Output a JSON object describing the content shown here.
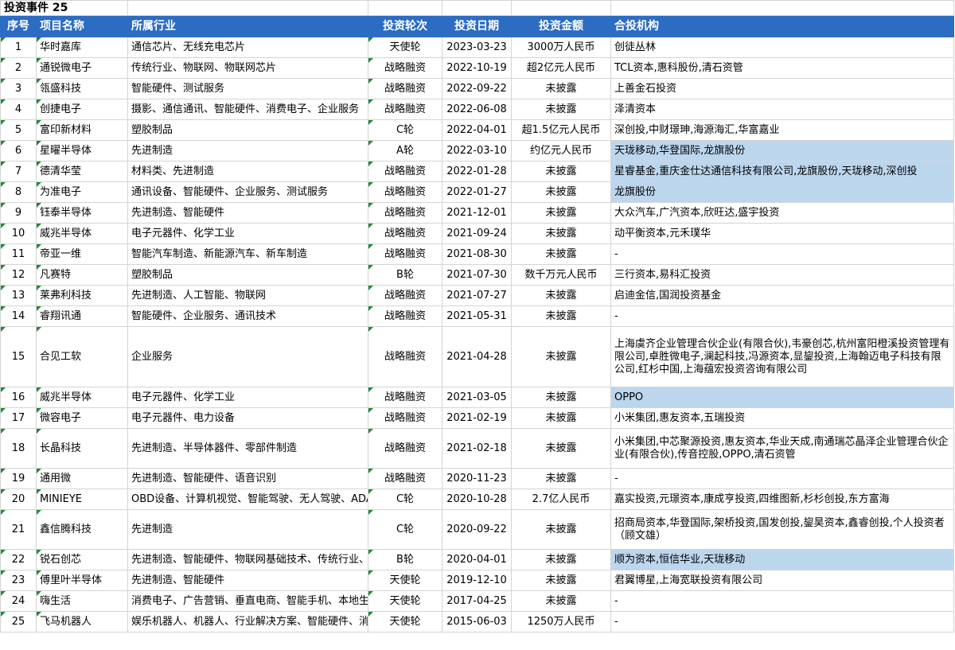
{
  "title": "投资事件 25",
  "headers": [
    "序号",
    "项目名称",
    "所属行业",
    "投资轮次",
    "投资日期",
    "投资金额",
    "合投机构"
  ],
  "rows": [
    {
      "no": "1",
      "name": "华时嘉库",
      "industry": "通信芯片、无线充电芯片",
      "round": "天使轮",
      "date": "2023-03-23",
      "amount": "3000万人民币",
      "investors": "创徒丛林",
      "highlight": false,
      "size": "r"
    },
    {
      "no": "2",
      "name": "通锐微电子",
      "industry": "传统行业、物联网、物联网芯片",
      "round": "战略融资",
      "date": "2022-10-19",
      "amount": "超2亿元人民币",
      "investors": "TCL资本,惠科股份,清石资管",
      "highlight": false,
      "size": "r"
    },
    {
      "no": "3",
      "name": "瓴盛科技",
      "industry": "智能硬件、测试服务",
      "round": "战略融资",
      "date": "2022-09-22",
      "amount": "未披露",
      "investors": "上善金石投资",
      "highlight": false,
      "size": "r"
    },
    {
      "no": "4",
      "name": "创捷电子",
      "industry": "摄影、通信通讯、智能硬件、消费电子、企业服务",
      "round": "战略融资",
      "date": "2022-06-08",
      "amount": "未披露",
      "investors": "泽清资本",
      "highlight": false,
      "size": "r"
    },
    {
      "no": "5",
      "name": "富印新材料",
      "industry": "塑胶制品",
      "round": "C轮",
      "date": "2022-04-01",
      "amount": "超1.5亿元人民币",
      "investors": "深创投,中财璟珅,海源海汇,华富嘉业",
      "highlight": false,
      "size": "r"
    },
    {
      "no": "6",
      "name": "星曜半导体",
      "industry": "先进制造",
      "round": "A轮",
      "date": "2022-03-10",
      "amount": "约亿元人民币",
      "investors": "天珑移动,华登国际,龙旗股份",
      "highlight": true,
      "size": "r"
    },
    {
      "no": "7",
      "name": "德清华莹",
      "industry": "材料类、先进制造",
      "round": "战略融资",
      "date": "2022-01-28",
      "amount": "未披露",
      "investors": "星睿基金,重庆金仕达通信科技有限公司,龙旗股份,天珑移动,深创投",
      "highlight": true,
      "size": "r"
    },
    {
      "no": "8",
      "name": "为准电子",
      "industry": "通讯设备、智能硬件、企业服务、测试服务",
      "round": "战略融资",
      "date": "2022-01-27",
      "amount": "未披露",
      "investors": "龙旗股份",
      "highlight": true,
      "size": "r"
    },
    {
      "no": "9",
      "name": "钰泰半导体",
      "industry": "先进制造、智能硬件",
      "round": "战略融资",
      "date": "2021-12-01",
      "amount": "未披露",
      "investors": "大众汽车,广汽资本,欣旺达,盛宇投资",
      "highlight": false,
      "size": "r"
    },
    {
      "no": "10",
      "name": "威兆半导体",
      "industry": "电子元器件、化学工业",
      "round": "战略融资",
      "date": "2021-09-24",
      "amount": "未披露",
      "investors": "动平衡资本,元禾璞华",
      "highlight": false,
      "size": "r"
    },
    {
      "no": "11",
      "name": "帝亚一维",
      "industry": "智能汽车制造、新能源汽车、新车制造",
      "round": "战略融资",
      "date": "2021-08-30",
      "amount": "未披露",
      "investors": "-",
      "highlight": false,
      "size": "r"
    },
    {
      "no": "12",
      "name": "凡赛特",
      "industry": "塑胶制品",
      "round": "B轮",
      "date": "2021-07-30",
      "amount": "数千万元人民币",
      "investors": "三行资本,易科汇投资",
      "highlight": false,
      "size": "r"
    },
    {
      "no": "13",
      "name": "莱弗利科技",
      "industry": "先进制造、人工智能、物联网",
      "round": "战略融资",
      "date": "2021-07-27",
      "amount": "未披露",
      "investors": "启迪金信,国润投资基金",
      "highlight": false,
      "size": "r"
    },
    {
      "no": "14",
      "name": "睿翔讯通",
      "industry": "智能硬件、企业服务、通讯技术",
      "round": "战略融资",
      "date": "2021-05-31",
      "amount": "未披露",
      "investors": "-",
      "highlight": false,
      "size": "r"
    },
    {
      "no": "15",
      "name": "合见工软",
      "industry": "企业服务",
      "round": "战略融资",
      "date": "2021-04-28",
      "amount": "未披露",
      "investors": "上海虞齐企业管理合伙企业(有限合伙),韦豪创芯,杭州富阳橙溪投资管理有限公司,卓胜微电子,澜起科技,冯源资本,显鋆投资,上海翰迈电子科技有限公司,红杉中国,上海蕴宏投资咨询有限公司",
      "highlight": false,
      "size": "r3"
    },
    {
      "no": "16",
      "name": "威兆半导体",
      "industry": "电子元器件、化学工业",
      "round": "战略融资",
      "date": "2021-03-05",
      "amount": "未披露",
      "investors": "OPPO",
      "highlight": true,
      "size": "r"
    },
    {
      "no": "17",
      "name": "微容电子",
      "industry": "电子元器件、电力设备",
      "round": "战略融资",
      "date": "2021-02-19",
      "amount": "未披露",
      "investors": "小米集团,惠友资本,五瑞投资",
      "highlight": false,
      "size": "r"
    },
    {
      "no": "18",
      "name": "长晶科技",
      "industry": "先进制造、半导体器件、零部件制造",
      "round": "战略融资",
      "date": "2021-02-18",
      "amount": "未披露",
      "investors": "小米集团,中芯聚源投资,惠友资本,华业天成,南通瑞芯晶泽企业管理合伙企业(有限合伙),传音控股,OPPO,清石资管",
      "highlight": false,
      "size": "r2"
    },
    {
      "no": "19",
      "name": "通用微",
      "industry": "先进制造、智能硬件、语音识别",
      "round": "战略融资",
      "date": "2020-11-23",
      "amount": "未披露",
      "investors": "-",
      "highlight": false,
      "size": "r"
    },
    {
      "no": "20",
      "name": "MINIEYE",
      "industry": "OBD设备、计算机视觉、智能驾驶、无人驾驶、ADAS",
      "round": "C轮",
      "date": "2020-10-28",
      "amount": "2.7亿人民币",
      "investors": "嘉实投资,元璟资本,康成亨投资,四维图新,杉杉创投,东方富海",
      "highlight": false,
      "size": "r"
    },
    {
      "no": "21",
      "name": "鑫信腾科技",
      "industry": "先进制造",
      "round": "C轮",
      "date": "2020-09-22",
      "amount": "未披露",
      "investors": "招商局资本,华登国际,架桥投资,国发创投,鋆昊资本,鑫睿创投,个人投资者（顾文雄）",
      "highlight": false,
      "size": "r2"
    },
    {
      "no": "22",
      "name": "锐石创芯",
      "industry": "先进制造、智能硬件、物联网基础技术、传统行业、",
      "round": "B轮",
      "date": "2020-04-01",
      "amount": "未披露",
      "investors": "顺为资本,恒信华业,天珑移动",
      "highlight": true,
      "size": "r"
    },
    {
      "no": "23",
      "name": "傅里叶半导体",
      "industry": "先进制造、智能硬件",
      "round": "天使轮",
      "date": "2019-12-10",
      "amount": "未披露",
      "investors": "君翼博星,上海宽联投资有限公司",
      "highlight": false,
      "size": "r"
    },
    {
      "no": "24",
      "name": "嗨生活",
      "industry": "消费电子、广告营销、垂直电商、智能手机、本地生活",
      "round": "天使轮",
      "date": "2017-04-25",
      "amount": "未披露",
      "investors": "-",
      "highlight": false,
      "size": "r"
    },
    {
      "no": "25",
      "name": "飞马机器人",
      "industry": "娱乐机器人、机器人、行业解决方案、智能硬件、消费",
      "round": "天使轮",
      "date": "2015-06-03",
      "amount": "1250万人民币",
      "investors": "-",
      "highlight": false,
      "size": "r"
    }
  ]
}
